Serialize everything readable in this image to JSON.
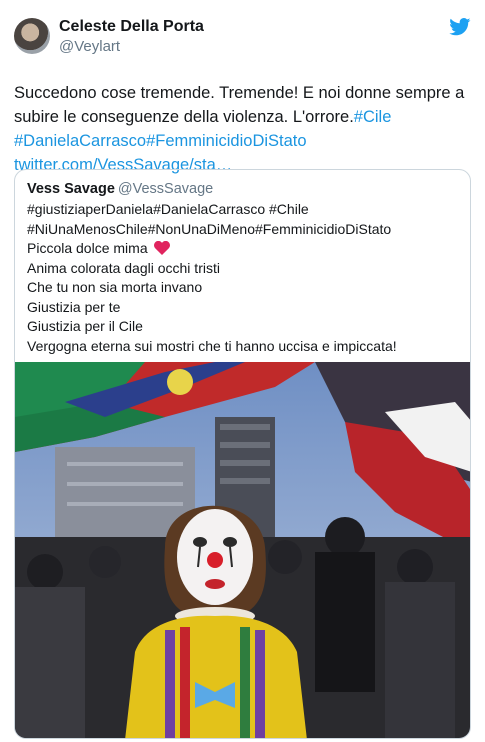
{
  "author": {
    "display_name": "Celeste Della Porta",
    "handle": "@Veylart"
  },
  "tweet": {
    "text_parts": [
      "Succedono cose tremende. Tremende! E noi donne sempre a subire le conseguenze della violenza. L'orrore.",
      "#Cile",
      "#DanielaCarrasco",
      "#FemminicidioDiStato",
      "twitter.com/VessSavage/sta…"
    ]
  },
  "quoted_tweet": {
    "display_name": "Vess Savage",
    "handle": "@VessSavage",
    "lines": [
      "#giustiziaperDaniela#DanielaCarrasco #Chile",
      "#NiUnaMenosChile#NonUnaDiMeno#FemminicidioDiStato",
      "Piccola dolce mima",
      "Anima colorata dagli occhi tristi",
      "Che tu non sia morta invano",
      "Giustizia per te",
      "Giustizia per il Cile",
      "Vergogna eterna sui mostri che ti hanno uccisa e impiccata!"
    ]
  },
  "icons": {
    "brand": "twitter-bird-icon",
    "emoji": "red-heart-icon"
  },
  "colors": {
    "link": "#1b95e0",
    "brand": "#1da1f2",
    "secondary_text": "#657786",
    "border": "#ccd6dd",
    "heart": "#e0245e"
  }
}
